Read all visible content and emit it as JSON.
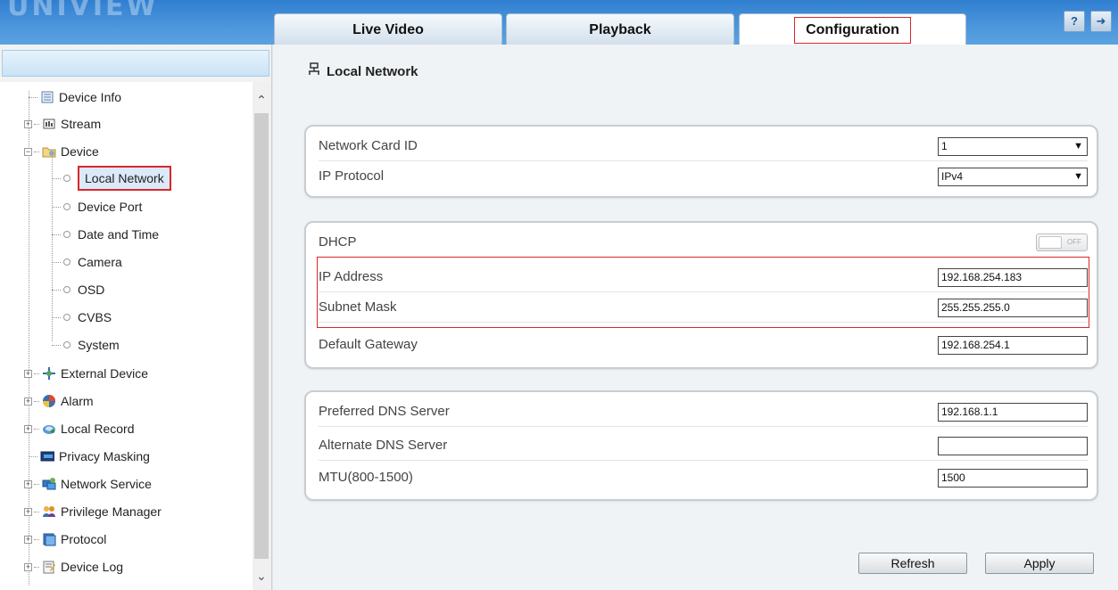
{
  "header": {
    "logo": "UNIVIEW",
    "tabs": [
      "Live Video",
      "Playback",
      "Configuration"
    ],
    "active_tab": "Configuration",
    "help_glyph": "?",
    "logout_glyph": "➜"
  },
  "sidebar": {
    "items": [
      {
        "label": "Device Info",
        "icon": "doc-icon"
      },
      {
        "label": "Stream",
        "icon": "stream-icon"
      },
      {
        "label": "Device",
        "icon": "folder-icon"
      },
      {
        "label": "Local Network"
      },
      {
        "label": "Device Port"
      },
      {
        "label": "Date and Time"
      },
      {
        "label": "Camera"
      },
      {
        "label": "OSD"
      },
      {
        "label": "CVBS"
      },
      {
        "label": "System"
      },
      {
        "label": "External Device",
        "icon": "external-device-icon"
      },
      {
        "label": "Alarm",
        "icon": "alarm-icon"
      },
      {
        "label": "Local Record",
        "icon": "local-record-icon"
      },
      {
        "label": "Privacy Masking",
        "icon": "privacy-masking-icon"
      },
      {
        "label": "Network Service",
        "icon": "network-service-icon"
      },
      {
        "label": "Privilege Manager",
        "icon": "privilege-manager-icon"
      },
      {
        "label": "Protocol",
        "icon": "protocol-icon"
      },
      {
        "label": "Device Log",
        "icon": "device-log-icon"
      }
    ],
    "selected": "Local Network"
  },
  "main": {
    "title": "Local Network",
    "network_card_id": {
      "label": "Network Card ID",
      "value": "1"
    },
    "ip_protocol": {
      "label": "IP Protocol",
      "value": "IPv4"
    },
    "dhcp": {
      "label": "DHCP",
      "state": "OFF"
    },
    "ip_address": {
      "label": "IP Address",
      "value": "192.168.254.183"
    },
    "subnet_mask": {
      "label": "Subnet Mask",
      "value": "255.255.255.0"
    },
    "default_gateway": {
      "label": "Default Gateway",
      "value": "192.168.254.1"
    },
    "preferred_dns": {
      "label": "Preferred DNS Server",
      "value": "192.168.1.1"
    },
    "alternate_dns": {
      "label": "Alternate DNS Server",
      "value": ""
    },
    "mtu": {
      "label": "MTU(800-1500)",
      "value": "1500"
    },
    "refresh_label": "Refresh",
    "apply_label": "Apply"
  },
  "colors": {
    "header": "#4d96dc",
    "highlight_border": "#d9272a",
    "panel_bg": "#ffffff"
  }
}
